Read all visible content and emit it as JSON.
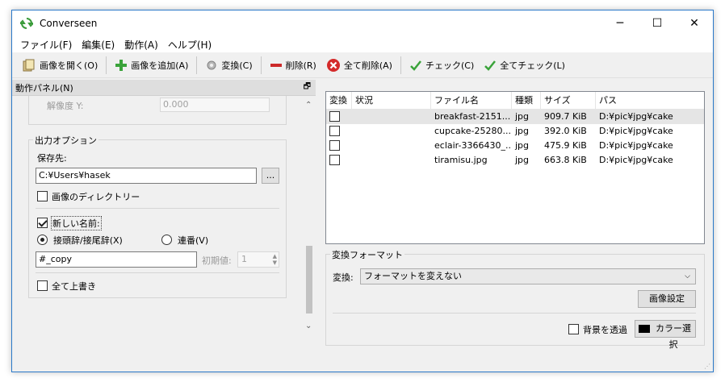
{
  "window": {
    "title": "Converseen"
  },
  "menu": [
    "ファイル(F)",
    "編集(E)",
    "動作(A)",
    "ヘルプ(H)"
  ],
  "toolbar": {
    "open": "画像を開く(O)",
    "add": "画像を追加(A)",
    "convert": "変換(C)",
    "delete": "削除(R)",
    "delete_all": "全て削除(A)",
    "check": "チェック(C)",
    "check_all": "全てチェック(L)"
  },
  "panel": {
    "title": "動作パネル(N)",
    "res_y_label": "解像度 Y:",
    "res_y_value": "0.000",
    "output_options": "出力オプション",
    "save_to_label": "保存先:",
    "save_to_value": "C:¥Users¥hasek",
    "browse": "...",
    "image_dir": "画像のディレクトリー",
    "new_name": "新しい名前:",
    "prefix_suffix": "接頭辞/接尾辞(X)",
    "sequence": "連番(V)",
    "rename_value": "#_copy",
    "initial_label": "初期値:",
    "initial_value": "1",
    "overwrite_all": "全て上書き"
  },
  "table": {
    "headers": [
      "変換",
      "状況",
      "ファイル名",
      "種類",
      "サイズ",
      "パス"
    ],
    "rows": [
      {
        "file": "breakfast-2151...",
        "type": "jpg",
        "size": "909.7 KiB",
        "path": "D:¥pic¥jpg¥cake"
      },
      {
        "file": "cupcake-25280...",
        "type": "jpg",
        "size": "392.0 KiB",
        "path": "D:¥pic¥jpg¥cake"
      },
      {
        "file": "eclair-3366430_...",
        "type": "jpg",
        "size": "475.9 KiB",
        "path": "D:¥pic¥jpg¥cake"
      },
      {
        "file": "tiramisu.jpg",
        "type": "jpg",
        "size": "663.8 KiB",
        "path": "D:¥pic¥jpg¥cake"
      }
    ]
  },
  "format": {
    "title": "変換フォーマット",
    "convert_label": "変換:",
    "convert_value": "フォーマットを変えない",
    "image_settings": "画像設定",
    "transparent_bg": "背景を透過",
    "color_select": "カラー選択"
  }
}
